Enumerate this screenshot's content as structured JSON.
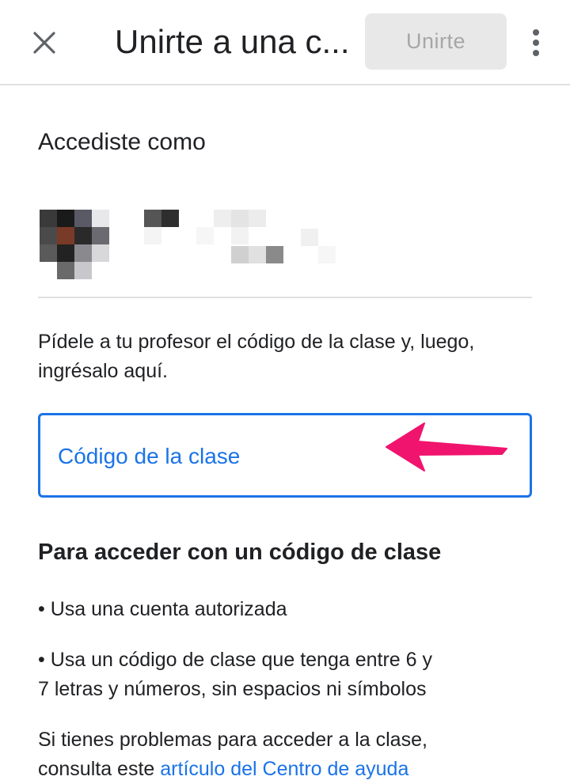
{
  "app_bar": {
    "title": "Unirte a una c...",
    "join_label": "Unirte",
    "close_icon": "close-icon",
    "more_icon": "more-vert-icon"
  },
  "account": {
    "heading": "Accediste como",
    "name": "",
    "email": ""
  },
  "instructions": {
    "text_line1": "Pídele a tu profesor el código de la clase y, luego,",
    "text_line2": "ingrésalo aquí."
  },
  "code_input": {
    "placeholder": "Código de la clase",
    "value": "",
    "border_color": "#1a73e8"
  },
  "annotation": {
    "arrow_icon": "pointer-arrow-icon",
    "arrow_color": "#f0146e"
  },
  "help": {
    "heading": "Para acceder con un código de clase",
    "bullet_1": "• Usa una cuenta autorizada",
    "bullet_2_line1": "• Usa un código de clase que tenga entre 6 y",
    "bullet_2_line2": "7 letras y números, sin espacios ni símbolos",
    "trouble_line1": "Si tienes problemas para acceder a la clase,",
    "trouble_line2_prefix": "consulta este",
    "help_link": "artículo del Centro de ayuda"
  },
  "colors": {
    "accent": "#1a73e8",
    "disabled_button_bg": "#e8e8e8",
    "disabled_button_text": "#a6a6a6",
    "divider": "#e0e0e0"
  }
}
